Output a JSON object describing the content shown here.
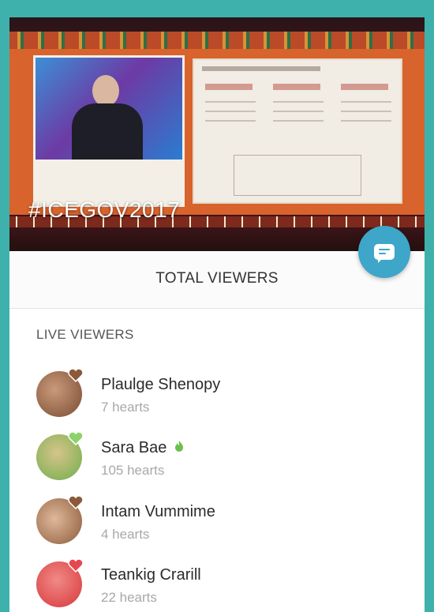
{
  "header": {
    "hashtag": "#ICEGOV2017",
    "chat_icon": "chat-bubble-icon"
  },
  "total": {
    "title": "TOTAL VIEWERS"
  },
  "live": {
    "label": "LIVE VIEWERS",
    "viewers": [
      {
        "name": "Plaulge Shenopy",
        "hearts": "7 hearts",
        "heart_color": "#8a5a3a",
        "avatar_color": "#9b6a4f",
        "has_flame": false
      },
      {
        "name": "Sara Bae",
        "hearts": "105 hearts",
        "heart_color": "#8cd36a",
        "avatar_color": "#7fbf5c",
        "has_flame": true
      },
      {
        "name": "Intam Vummime",
        "hearts": "4 hearts",
        "heart_color": "#8a5a3a",
        "avatar_color": "#b07a5a",
        "has_flame": false
      },
      {
        "name": "Teankig Crarill",
        "hearts": "22 hearts",
        "heart_color": "#e8474f",
        "avatar_color": "#e24b4f",
        "has_flame": false
      }
    ]
  },
  "colors": {
    "accent": "#3ea6c9",
    "frame": "#3fb1ad",
    "flame": "#6cc04a"
  }
}
